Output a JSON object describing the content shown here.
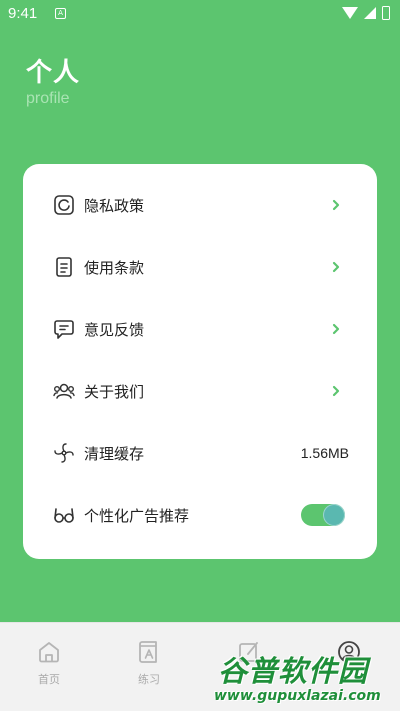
{
  "status_bar": {
    "time": "9:41",
    "notification_glyph": "A"
  },
  "header": {
    "title": "个人",
    "subtitle": "profile"
  },
  "settings": {
    "items": [
      {
        "label": "隐私政策",
        "icon": "privacy-icon"
      },
      {
        "label": "使用条款",
        "icon": "document-icon"
      },
      {
        "label": "意见反馈",
        "icon": "feedback-icon"
      },
      {
        "label": "关于我们",
        "icon": "about-us-icon"
      },
      {
        "label": "清理缓存",
        "icon": "fan-icon",
        "value": "1.56MB"
      },
      {
        "label": "个性化广告推荐",
        "icon": "glasses-icon",
        "toggle_on": true
      }
    ]
  },
  "bottom_nav": {
    "items": [
      {
        "label": "首页",
        "icon": "home-icon"
      },
      {
        "label": "练习",
        "icon": "practice-icon"
      },
      {
        "label": "",
        "icon": "edit-icon"
      },
      {
        "label": "",
        "icon": "user-icon"
      }
    ]
  },
  "watermark": {
    "logo": "谷普软件园",
    "url": "www.gupuxlazai.com"
  },
  "colors": {
    "primary_green": "#5cc56f",
    "card_bg": "#ffffff",
    "chevron": "#5cc56f",
    "watermark_green": "#1f8f3a"
  }
}
